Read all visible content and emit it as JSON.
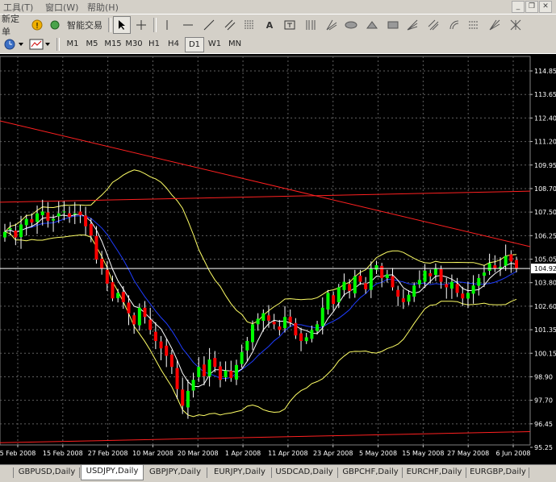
{
  "menu": {
    "items": [
      "工具(T)",
      "窗口(W)",
      "帮助(H)"
    ]
  },
  "window_controls": {
    "minimize": "_",
    "restore": "❐",
    "close": "✕"
  },
  "toolbar": {
    "new_order": "新定单",
    "expert_advisors": "智能交易",
    "text_tool_label": "A",
    "timeframes": [
      "M1",
      "M5",
      "M15",
      "M30",
      "H1",
      "H4",
      "D1",
      "W1",
      "MN"
    ],
    "active_timeframe": "D1"
  },
  "chart_data": {
    "type": "candlestick",
    "symbol": "USDJPY",
    "period": "Daily",
    "ylim": [
      95.25,
      115.6
    ],
    "y_ticks": [
      "114.85",
      "113.65",
      "112.40",
      "111.20",
      "109.95",
      "108.70",
      "107.50",
      "106.25",
      "105.05",
      "103.80",
      "102.60",
      "101.35",
      "100.15",
      "98.90",
      "97.70",
      "96.45",
      "95.25"
    ],
    "x_ticks": [
      "5 Feb 2008",
      "15 Feb 2008",
      "27 Feb 2008",
      "10 Mar 2008",
      "20 Mar 2008",
      "1 Apr 2008",
      "11 Apr 2008",
      "23 Apr 2008",
      "5 May 2008",
      "15 May 2008",
      "27 May 2008",
      "6 Jun 2008"
    ],
    "current_price": "104.92",
    "grid": true,
    "bullish_color": "#00ff00",
    "bearish_color": "#ff0000",
    "closes": [
      106.9,
      107.1,
      106.6,
      107.3,
      107.6,
      107.4,
      107.9,
      108.0,
      107.5,
      107.6,
      107.9,
      108.0,
      107.7,
      107.9,
      107.8,
      107.2,
      106.7,
      105.4,
      104.9,
      104.1,
      103.3,
      103.6,
      103.1,
      102.5,
      101.9,
      102.8,
      102.3,
      101.6,
      101.0,
      100.6,
      100.2,
      99.6,
      98.4,
      97.5,
      98.3,
      98.9,
      99.6,
      99.1,
      100.0,
      99.6,
      98.9,
      99.4,
      99.0,
      99.7,
      100.4,
      101.0,
      101.9,
      102.2,
      102.5,
      102.1,
      101.9,
      101.6,
      102.3,
      102.0,
      101.3,
      101.0,
      101.2,
      101.6,
      101.9,
      102.8,
      103.6,
      103.0,
      103.9,
      104.2,
      103.7,
      104.5,
      104.2,
      103.8,
      104.9,
      105.1,
      104.4,
      104.6,
      103.9,
      103.4,
      103.1,
      103.5,
      104.0,
      104.3,
      104.8,
      104.5,
      104.9,
      104.2,
      103.9,
      104.2,
      103.6,
      103.3,
      103.6,
      104.0,
      104.4,
      104.7,
      105.2,
      104.9,
      105.0,
      105.6,
      105.3,
      104.9
    ]
  },
  "symbol_tabs": [
    "",
    "GBPUSD,Daily",
    "USDJPY,Daily",
    "GBPJPY,Daily",
    "EURJPY,Daily",
    "USDCAD,Daily",
    "GBPCHF,Daily",
    "EURCHF,Daily",
    "EURGBP,Daily",
    ""
  ],
  "active_tab": "USDJPY,Daily"
}
